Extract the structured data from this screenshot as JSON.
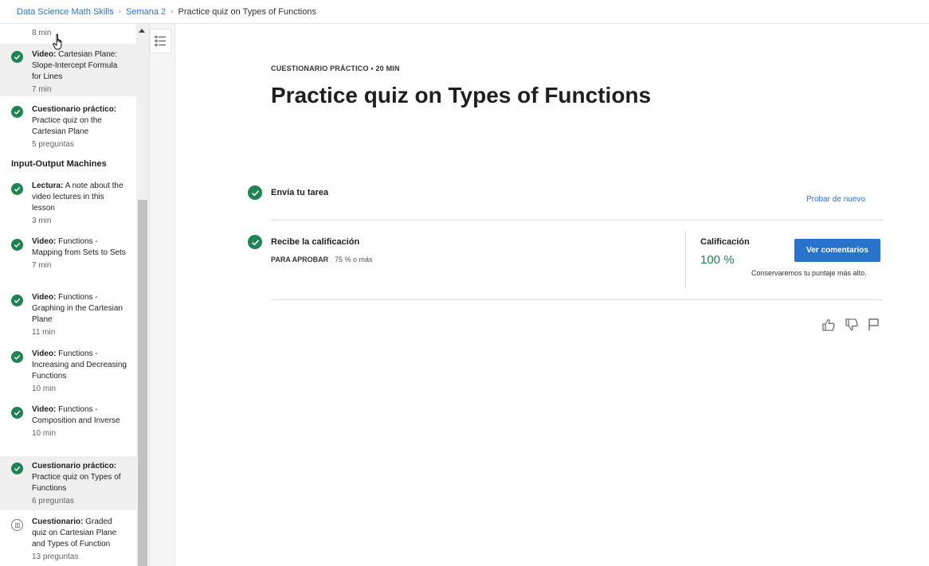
{
  "breadcrumb": {
    "items": [
      "Data Science Math Skills",
      "Semana 2"
    ],
    "current": "Practice quiz on Types of Functions"
  },
  "sidebar": {
    "top_meta": "8 min",
    "section_title": "Input-Output Machines",
    "items": [
      {
        "type": "Video:",
        "title": "Cartesian Plane: Slope-Intercept Formula for Lines",
        "meta": "7 min"
      },
      {
        "type": "Cuestionario práctico:",
        "title": "Practice quiz on the Cartesian Plane",
        "meta": "5 preguntas"
      },
      {
        "type": "Lectura:",
        "title": "A note about the video lectures in this lesson",
        "meta": "3 min"
      },
      {
        "type": "Video:",
        "title": "Functions - Mapping from Sets to Sets",
        "meta": "7 min"
      },
      {
        "type": "Video:",
        "title": "Functions - Graphing in the Cartesian Plane",
        "meta": "11 min"
      },
      {
        "type": "Video:",
        "title": "Functions - Increasing and Decreasing Functions",
        "meta": "10 min"
      },
      {
        "type": "Video:",
        "title": "Functions - Composition and Inverse",
        "meta": "10 min"
      },
      {
        "type": "Cuestionario práctico:",
        "title": "Practice quiz on Types of Functions",
        "meta": "6 preguntas"
      },
      {
        "type": "Cuestionario:",
        "title": "Graded quiz on Cartesian Plane and Types of Function",
        "meta": "13 preguntas"
      }
    ]
  },
  "main": {
    "eyebrow": "CUESTIONARIO PRÁCTICO • 20 MIN",
    "title": "Practice quiz on Types of Functions",
    "step1": {
      "label": "Envía tu tarea",
      "action": "Probar de nuevo"
    },
    "step2": {
      "label": "Recibe la calificación",
      "pass_label": "PARA APROBAR",
      "pass_value": "75 % o más",
      "grade_label": "Calificación",
      "grade_value": "100 %",
      "button": "Ver comentarios",
      "note": "Conservaremos tu puntaje más alto."
    }
  },
  "colors": {
    "accent": "#2a73cc",
    "success": "#1f8354"
  },
  "icons": [
    "table-of-contents-icon",
    "like-icon",
    "dislike-icon",
    "flag-icon",
    "checkmark-icon",
    "quiz-icon"
  ]
}
